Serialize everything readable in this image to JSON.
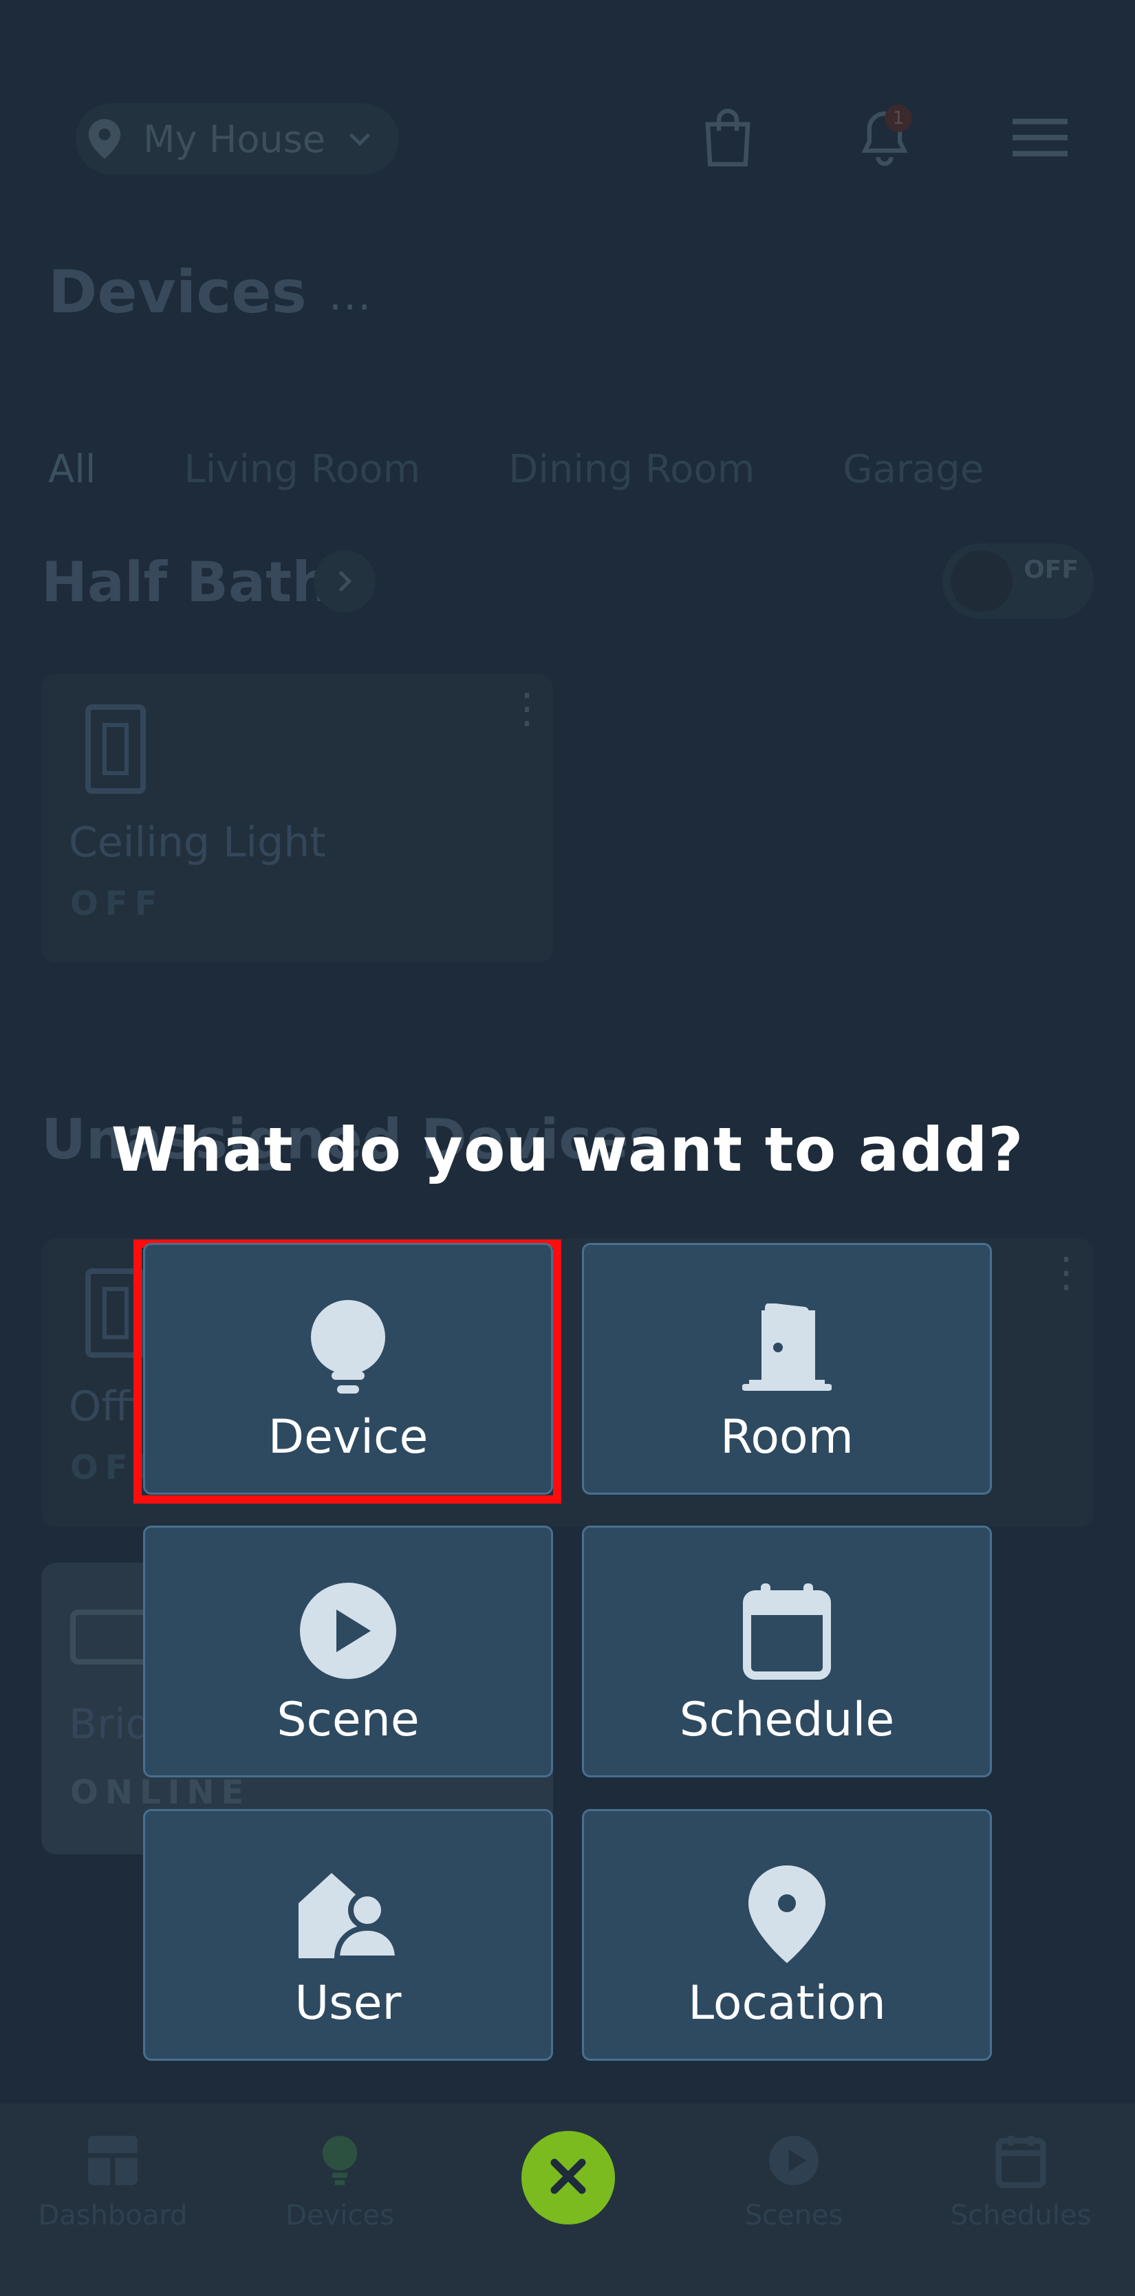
{
  "header": {
    "location_name": "My House",
    "notification_count": "1"
  },
  "page": {
    "title": "Devices",
    "more": "..."
  },
  "tabs": [
    "All",
    "Living Room",
    "Dining Room",
    "Garage"
  ],
  "sections": {
    "half_bath": {
      "title": "Half Bath",
      "toggle_label": "OFF",
      "card": {
        "title": "Ceiling Light",
        "status": "OFF"
      }
    },
    "unassigned": {
      "title": "Unassigned Devices",
      "cards": [
        {
          "title": "Office",
          "status": "OFF"
        },
        {
          "title": "Bridge",
          "status": "ONLINE"
        }
      ]
    }
  },
  "bottom_nav": {
    "items": [
      {
        "label": "Dashboard",
        "icon": "dashboard-icon"
      },
      {
        "label": "Devices",
        "icon": "bulb-icon"
      },
      {
        "label": "Scenes",
        "icon": "play-icon"
      },
      {
        "label": "Schedules",
        "icon": "calendar-icon"
      }
    ],
    "close_icon": "close-icon"
  },
  "modal": {
    "title": "What do you want to add?",
    "options": [
      {
        "label": "Device",
        "icon": "bulb-icon"
      },
      {
        "label": "Room",
        "icon": "door-icon"
      },
      {
        "label": "Scene",
        "icon": "play-icon"
      },
      {
        "label": "Schedule",
        "icon": "calendar-icon"
      },
      {
        "label": "User",
        "icon": "user-home-icon"
      },
      {
        "label": "Location",
        "icon": "location-pin-icon"
      }
    ]
  },
  "colors": {
    "background": "#1d2b3a",
    "tile_bg": "#2e4a61",
    "tile_border": "#47708f",
    "highlight": "#ff0d0d",
    "fab": "#7bbb1f"
  }
}
